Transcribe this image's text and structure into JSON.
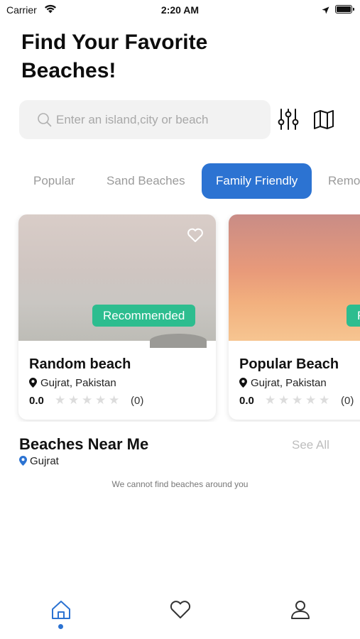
{
  "status_bar": {
    "carrier": "Carrier",
    "time": "2:20 AM",
    "icons": [
      "wifi-icon",
      "location-arrow-icon",
      "battery-icon"
    ]
  },
  "header": {
    "title": "Find Your Favorite Beaches!"
  },
  "search": {
    "placeholder": "Enter an island,city or beach",
    "value": "",
    "icons": [
      "search-icon",
      "filter-sliders-icon",
      "map-icon"
    ]
  },
  "tabs": [
    {
      "label": "Popular",
      "active": false
    },
    {
      "label": "Sand Beaches",
      "active": false
    },
    {
      "label": "Family Friendly",
      "active": true
    },
    {
      "label": "Remo",
      "active": false
    }
  ],
  "cards": [
    {
      "name": "Random beach",
      "location": "Gujrat, Pakistan",
      "rating": "0.0",
      "stars": 5,
      "review_count": "(0)",
      "badge": "Recommended",
      "favorite": false
    },
    {
      "name": "Popular Beach",
      "location": "Gujrat, Pakistan",
      "rating": "0.0",
      "stars": 5,
      "review_count": "(0)",
      "badge": "R",
      "favorite": false
    }
  ],
  "near_me": {
    "title": "Beaches Near Me",
    "see_all": "See All",
    "location": "Gujrat",
    "empty_message": "We cannot find beaches around you"
  },
  "bottom_nav": [
    {
      "icon": "home-icon",
      "active": true
    },
    {
      "icon": "heart-icon",
      "active": false
    },
    {
      "icon": "profile-icon",
      "active": false
    }
  ],
  "colors": {
    "accent": "#2c73d2",
    "badge": "#2dbd8f",
    "muted_text": "#9b9b9b",
    "search_bg": "#f2f2f2"
  }
}
